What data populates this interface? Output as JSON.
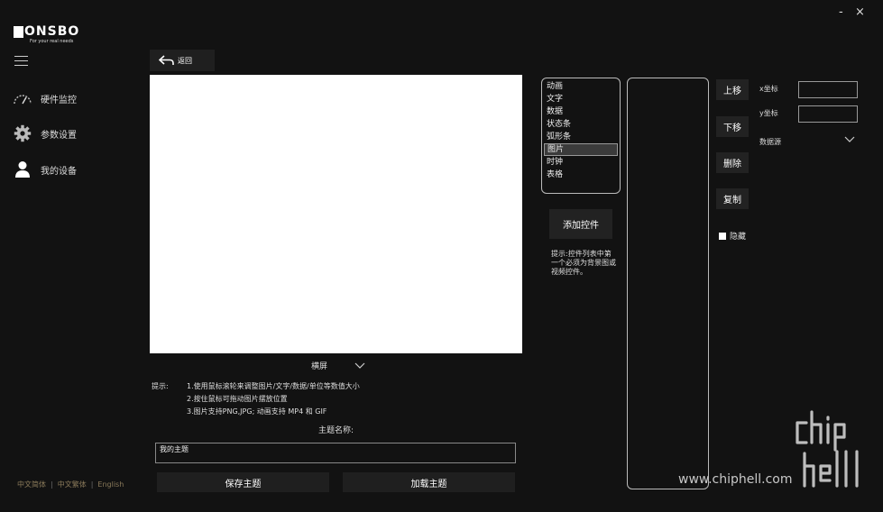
{
  "window": {
    "minimize": "-",
    "close": "×"
  },
  "brand": {
    "name": "ONSBO",
    "tagline": "For your real needs"
  },
  "sidebar": {
    "items": [
      {
        "label": "硬件监控",
        "icon": "speedometer-icon"
      },
      {
        "label": "参数设置",
        "icon": "gear-icon"
      },
      {
        "label": "我的设备",
        "icon": "user-icon"
      }
    ]
  },
  "languages": [
    "中文简体",
    "中文繁体",
    "English"
  ],
  "toolbar": {
    "back_label": "返回"
  },
  "preview": {
    "orientation": "横屏"
  },
  "tips": {
    "label": "提示:",
    "lines": [
      "1.使用鼠标滚轮来调整图片/文字/数据/单位等数值大小",
      "2.按住鼠标可拖动图片摆放位置",
      "3.图片支持PNG,JPG; 动画支持 MP4 和 GIF"
    ]
  },
  "theme": {
    "name_label": "主题名称:",
    "name_value": "我的主题",
    "save_label": "保存主题",
    "load_label": "加载主题"
  },
  "widgets": {
    "items": [
      "动画",
      "文字",
      "数据",
      "状态条",
      "弧形条",
      "图片",
      "时钟",
      "表格"
    ],
    "selected_index": 5,
    "add_label": "添加控件",
    "hint": "提示:控件列表中第一个必须为背景图或视频控件。"
  },
  "actions": {
    "up": "上移",
    "down": "下移",
    "delete": "删除",
    "copy": "复制",
    "hide": "隐藏"
  },
  "props": {
    "x_label": "x坐标",
    "y_label": "y坐标",
    "datasource_label": "数据源"
  },
  "watermark": {
    "text": "www.chiphell.com"
  },
  "colors": {
    "background": "#121212",
    "panel": "#1f1f1f",
    "lang_text": "#8a7a5a"
  }
}
